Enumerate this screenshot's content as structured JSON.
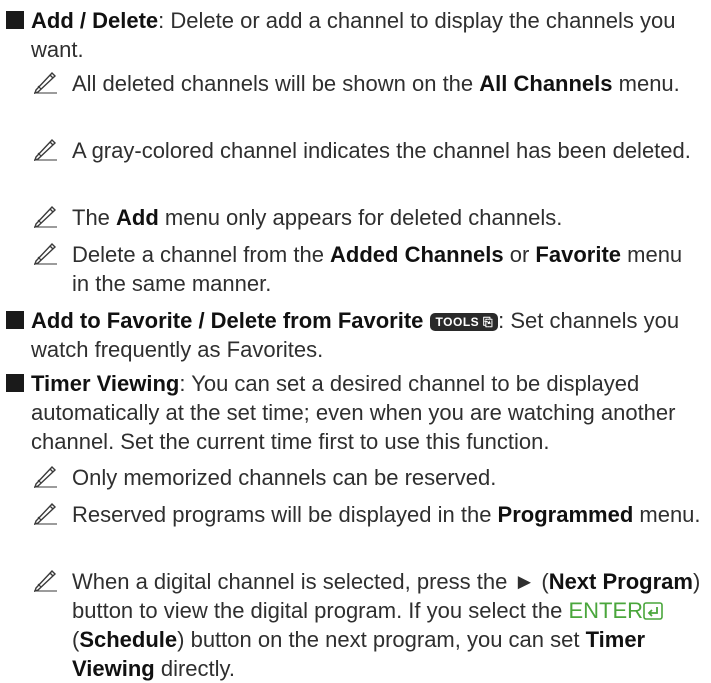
{
  "items": [
    {
      "title": "Add / Delete",
      "colon": ":",
      "desc": " Delete or add a channel to display the channels you want."
    },
    {
      "title": "Add to Favorite / Delete from Favorite",
      "tools_label": "TOOLS",
      "colon": ":",
      "desc": " Set channels you watch frequently as Favorites."
    },
    {
      "title": "Timer Viewing",
      "colon": ":",
      "desc": " You can set a desired channel to be displayed automatically at the set time; even when you are watching another channel. Set the current time first to use this function."
    }
  ],
  "notes_add_delete": [
    {
      "a": "All deleted channels will be shown on the ",
      "b": "All Channels",
      "c": " menu."
    },
    {
      "a": "A gray-colored channel indicates the channel has been deleted."
    },
    {
      "a": "The ",
      "b": "Add",
      "c": " menu only appears for deleted channels."
    },
    {
      "a": "Delete a channel from the ",
      "b": "Added Channels",
      "c": " or ",
      "d": "Favorite",
      "e": " menu in the same manner."
    }
  ],
  "notes_timer": [
    {
      "a": "Only memorized channels can be reserved."
    },
    {
      "a": "Reserved programs will be displayed in the ",
      "b": "Programmed",
      "c": " menu."
    },
    {
      "a": "When a digital channel is selected, press the ► (",
      "b": "Next Program",
      "c": ") button to view the digital program. If you select the ",
      "enter": "ENTER",
      "d": "(",
      "e": "Schedule",
      "f": ") button on the next program, you can set ",
      "g": "Timer Viewing",
      "h": " directly."
    }
  ],
  "icons": {
    "bullet": "square-bullet-icon",
    "note": "pencil-note-icon",
    "tools": "tools-key-icon",
    "enter": "enter-key-icon"
  },
  "colors": {
    "text": "#2f2f2f",
    "bold": "#111111",
    "enter": "#4aa63c"
  }
}
